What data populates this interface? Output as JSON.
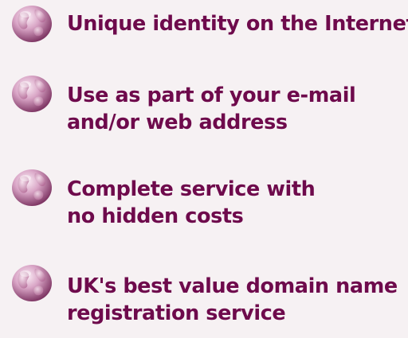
{
  "features": [
    {
      "lines": [
        "Unique identity on the Internet"
      ],
      "icon": "globe-icon"
    },
    {
      "lines": [
        "Use as part of your e-mail",
        "and/or web address"
      ],
      "icon": "globe-icon"
    },
    {
      "lines": [
        "Complete service with",
        "no hidden costs"
      ],
      "icon": "globe-icon"
    },
    {
      "lines": [
        "UK's best value domain name",
        "registration service"
      ],
      "icon": "globe-icon"
    }
  ],
  "colors": {
    "text": "#6e0a4c",
    "background": "#f6f1f3",
    "globe_light": "#f2d8e8",
    "globe_dark": "#8a3f6e"
  }
}
